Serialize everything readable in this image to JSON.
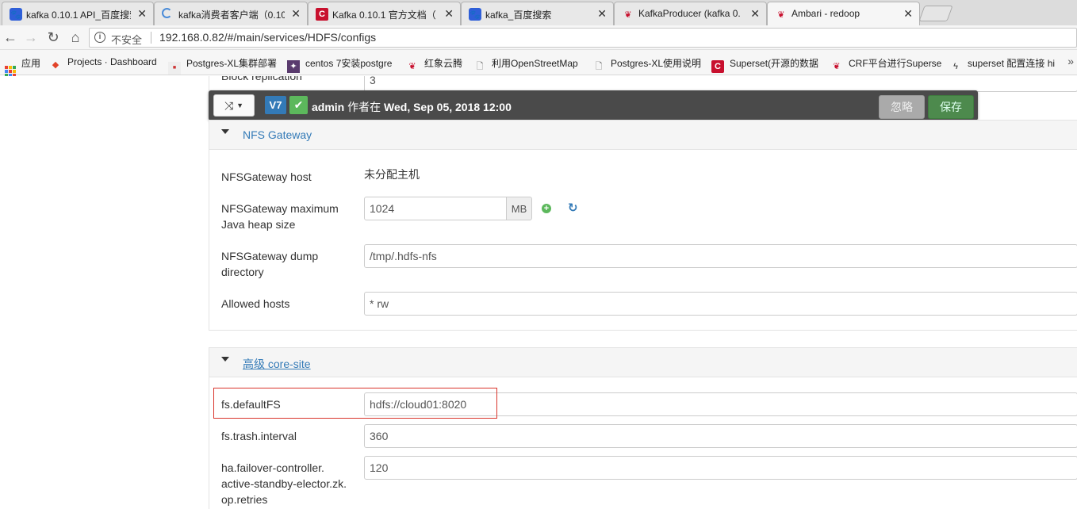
{
  "browser": {
    "tabs": [
      {
        "title": "kafka 0.10.1 API_百度搜索",
        "icon": "baidu-paw-icon"
      },
      {
        "title": "kafka消费者客户端（0.10",
        "icon": "loading-spinner-icon"
      },
      {
        "title": "Kafka 0.10.1 官方文档（",
        "icon": "csdn-icon"
      },
      {
        "title": "kafka_百度搜索",
        "icon": "baidu-paw-icon"
      },
      {
        "title": "KafkaProducer (kafka 0.",
        "icon": "feather-icon"
      },
      {
        "title": "Ambari - redoop",
        "icon": "feather-icon"
      }
    ],
    "address": {
      "security_label": "不安全",
      "url": "192.168.0.82/#/main/services/HDFS/configs"
    },
    "bookmarks": [
      {
        "label": "应用",
        "icon": "apps-grid-icon"
      },
      {
        "label": "Projects · Dashboard",
        "icon": "gitlab-icon"
      },
      {
        "label": "Postgres-XL集群部署",
        "icon": "site-icon"
      },
      {
        "label": "centos 7安装postgre",
        "icon": "site-icon"
      },
      {
        "label": "红象云腾",
        "icon": "feather-icon"
      },
      {
        "label": "利用OpenStreetMap",
        "icon": "page-icon"
      },
      {
        "label": "Postgres-XL使用说明",
        "icon": "page-icon"
      },
      {
        "label": "Superset(开源的数据",
        "icon": "csdn-icon"
      },
      {
        "label": "CRF平台进行Superse",
        "icon": "feather-icon"
      },
      {
        "label": "superset 配置连接 hi",
        "icon": "site-icon"
      }
    ]
  },
  "version_bar": {
    "version": "V7",
    "author": "admin",
    "author_prefix": "作者在",
    "date": "Wed, Sep 05, 2018 12:00",
    "discard_label": "忽略",
    "save_label": "保存"
  },
  "previous_row": {
    "label": "Block replication",
    "value": "3"
  },
  "nfs_gateway": {
    "title": "NFS Gateway",
    "host_label": "NFSGateway host",
    "host_value": "未分配主机",
    "heap_label_line1": "NFSGateway maximum",
    "heap_label_line2": "Java heap size",
    "heap_value": "1024",
    "heap_unit": "MB",
    "dump_label_line1": "NFSGateway dump",
    "dump_label_line2": "directory",
    "dump_value": "/tmp/.hdfs-nfs",
    "allowed_label": "Allowed hosts",
    "allowed_value": "* rw"
  },
  "core_site": {
    "title": "高级 core-site",
    "rows": [
      {
        "label": "fs.defaultFS",
        "value": "hdfs://cloud01:8020"
      },
      {
        "label": "fs.trash.interval",
        "value": "360"
      },
      {
        "label_lines": [
          "ha.failover-controller.",
          "active-standby-elector.zk.",
          "op.retries"
        ],
        "value": "120"
      }
    ]
  },
  "colors": {
    "link": "#337ab7",
    "version_badge": "#337ab7",
    "ok_badge": "#5cb85c",
    "save_button": "#4d8a4d",
    "highlight": "#d9342b"
  }
}
